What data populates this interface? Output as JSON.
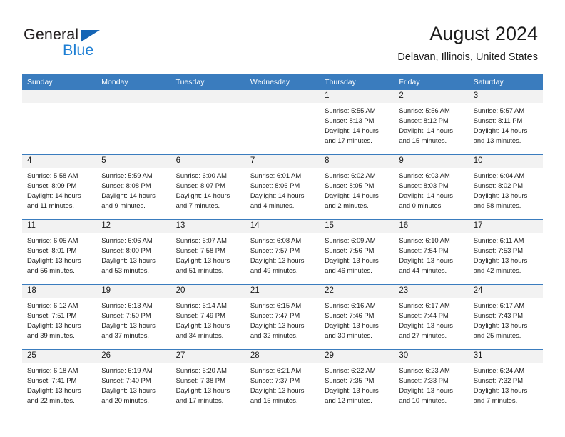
{
  "brand": {
    "name_top": "General",
    "name_bottom": "Blue",
    "top_color": "#231f20",
    "bottom_color": "#1e7fd4",
    "triangle_color": "#1565b5"
  },
  "header": {
    "title": "August 2024",
    "subtitle": "Delavan, Illinois, United States"
  },
  "theme": {
    "header_bg": "#3a7cbe",
    "header_text": "#ffffff",
    "daynum_bg": "#f2f2f2",
    "cell_bg": "#ffffff",
    "row_divider": "#3a7cbe"
  },
  "weekday_headers": [
    "Sunday",
    "Monday",
    "Tuesday",
    "Wednesday",
    "Thursday",
    "Friday",
    "Saturday"
  ],
  "weeks": [
    [
      {
        "day": "",
        "sunrise": "",
        "sunset": "",
        "daylight": "",
        "empty": true
      },
      {
        "day": "",
        "sunrise": "",
        "sunset": "",
        "daylight": "",
        "empty": true
      },
      {
        "day": "",
        "sunrise": "",
        "sunset": "",
        "daylight": "",
        "empty": true
      },
      {
        "day": "",
        "sunrise": "",
        "sunset": "",
        "daylight": "",
        "empty": true
      },
      {
        "day": "1",
        "sunrise": "Sunrise: 5:55 AM",
        "sunset": "Sunset: 8:13 PM",
        "daylight": "Daylight: 14 hours and 17 minutes."
      },
      {
        "day": "2",
        "sunrise": "Sunrise: 5:56 AM",
        "sunset": "Sunset: 8:12 PM",
        "daylight": "Daylight: 14 hours and 15 minutes."
      },
      {
        "day": "3",
        "sunrise": "Sunrise: 5:57 AM",
        "sunset": "Sunset: 8:11 PM",
        "daylight": "Daylight: 14 hours and 13 minutes."
      }
    ],
    [
      {
        "day": "4",
        "sunrise": "Sunrise: 5:58 AM",
        "sunset": "Sunset: 8:09 PM",
        "daylight": "Daylight: 14 hours and 11 minutes."
      },
      {
        "day": "5",
        "sunrise": "Sunrise: 5:59 AM",
        "sunset": "Sunset: 8:08 PM",
        "daylight": "Daylight: 14 hours and 9 minutes."
      },
      {
        "day": "6",
        "sunrise": "Sunrise: 6:00 AM",
        "sunset": "Sunset: 8:07 PM",
        "daylight": "Daylight: 14 hours and 7 minutes."
      },
      {
        "day": "7",
        "sunrise": "Sunrise: 6:01 AM",
        "sunset": "Sunset: 8:06 PM",
        "daylight": "Daylight: 14 hours and 4 minutes."
      },
      {
        "day": "8",
        "sunrise": "Sunrise: 6:02 AM",
        "sunset": "Sunset: 8:05 PM",
        "daylight": "Daylight: 14 hours and 2 minutes."
      },
      {
        "day": "9",
        "sunrise": "Sunrise: 6:03 AM",
        "sunset": "Sunset: 8:03 PM",
        "daylight": "Daylight: 14 hours and 0 minutes."
      },
      {
        "day": "10",
        "sunrise": "Sunrise: 6:04 AM",
        "sunset": "Sunset: 8:02 PM",
        "daylight": "Daylight: 13 hours and 58 minutes."
      }
    ],
    [
      {
        "day": "11",
        "sunrise": "Sunrise: 6:05 AM",
        "sunset": "Sunset: 8:01 PM",
        "daylight": "Daylight: 13 hours and 56 minutes."
      },
      {
        "day": "12",
        "sunrise": "Sunrise: 6:06 AM",
        "sunset": "Sunset: 8:00 PM",
        "daylight": "Daylight: 13 hours and 53 minutes."
      },
      {
        "day": "13",
        "sunrise": "Sunrise: 6:07 AM",
        "sunset": "Sunset: 7:58 PM",
        "daylight": "Daylight: 13 hours and 51 minutes."
      },
      {
        "day": "14",
        "sunrise": "Sunrise: 6:08 AM",
        "sunset": "Sunset: 7:57 PM",
        "daylight": "Daylight: 13 hours and 49 minutes."
      },
      {
        "day": "15",
        "sunrise": "Sunrise: 6:09 AM",
        "sunset": "Sunset: 7:56 PM",
        "daylight": "Daylight: 13 hours and 46 minutes."
      },
      {
        "day": "16",
        "sunrise": "Sunrise: 6:10 AM",
        "sunset": "Sunset: 7:54 PM",
        "daylight": "Daylight: 13 hours and 44 minutes."
      },
      {
        "day": "17",
        "sunrise": "Sunrise: 6:11 AM",
        "sunset": "Sunset: 7:53 PM",
        "daylight": "Daylight: 13 hours and 42 minutes."
      }
    ],
    [
      {
        "day": "18",
        "sunrise": "Sunrise: 6:12 AM",
        "sunset": "Sunset: 7:51 PM",
        "daylight": "Daylight: 13 hours and 39 minutes."
      },
      {
        "day": "19",
        "sunrise": "Sunrise: 6:13 AM",
        "sunset": "Sunset: 7:50 PM",
        "daylight": "Daylight: 13 hours and 37 minutes."
      },
      {
        "day": "20",
        "sunrise": "Sunrise: 6:14 AM",
        "sunset": "Sunset: 7:49 PM",
        "daylight": "Daylight: 13 hours and 34 minutes."
      },
      {
        "day": "21",
        "sunrise": "Sunrise: 6:15 AM",
        "sunset": "Sunset: 7:47 PM",
        "daylight": "Daylight: 13 hours and 32 minutes."
      },
      {
        "day": "22",
        "sunrise": "Sunrise: 6:16 AM",
        "sunset": "Sunset: 7:46 PM",
        "daylight": "Daylight: 13 hours and 30 minutes."
      },
      {
        "day": "23",
        "sunrise": "Sunrise: 6:17 AM",
        "sunset": "Sunset: 7:44 PM",
        "daylight": "Daylight: 13 hours and 27 minutes."
      },
      {
        "day": "24",
        "sunrise": "Sunrise: 6:17 AM",
        "sunset": "Sunset: 7:43 PM",
        "daylight": "Daylight: 13 hours and 25 minutes."
      }
    ],
    [
      {
        "day": "25",
        "sunrise": "Sunrise: 6:18 AM",
        "sunset": "Sunset: 7:41 PM",
        "daylight": "Daylight: 13 hours and 22 minutes."
      },
      {
        "day": "26",
        "sunrise": "Sunrise: 6:19 AM",
        "sunset": "Sunset: 7:40 PM",
        "daylight": "Daylight: 13 hours and 20 minutes."
      },
      {
        "day": "27",
        "sunrise": "Sunrise: 6:20 AM",
        "sunset": "Sunset: 7:38 PM",
        "daylight": "Daylight: 13 hours and 17 minutes."
      },
      {
        "day": "28",
        "sunrise": "Sunrise: 6:21 AM",
        "sunset": "Sunset: 7:37 PM",
        "daylight": "Daylight: 13 hours and 15 minutes."
      },
      {
        "day": "29",
        "sunrise": "Sunrise: 6:22 AM",
        "sunset": "Sunset: 7:35 PM",
        "daylight": "Daylight: 13 hours and 12 minutes."
      },
      {
        "day": "30",
        "sunrise": "Sunrise: 6:23 AM",
        "sunset": "Sunset: 7:33 PM",
        "daylight": "Daylight: 13 hours and 10 minutes."
      },
      {
        "day": "31",
        "sunrise": "Sunrise: 6:24 AM",
        "sunset": "Sunset: 7:32 PM",
        "daylight": "Daylight: 13 hours and 7 minutes."
      }
    ]
  ]
}
